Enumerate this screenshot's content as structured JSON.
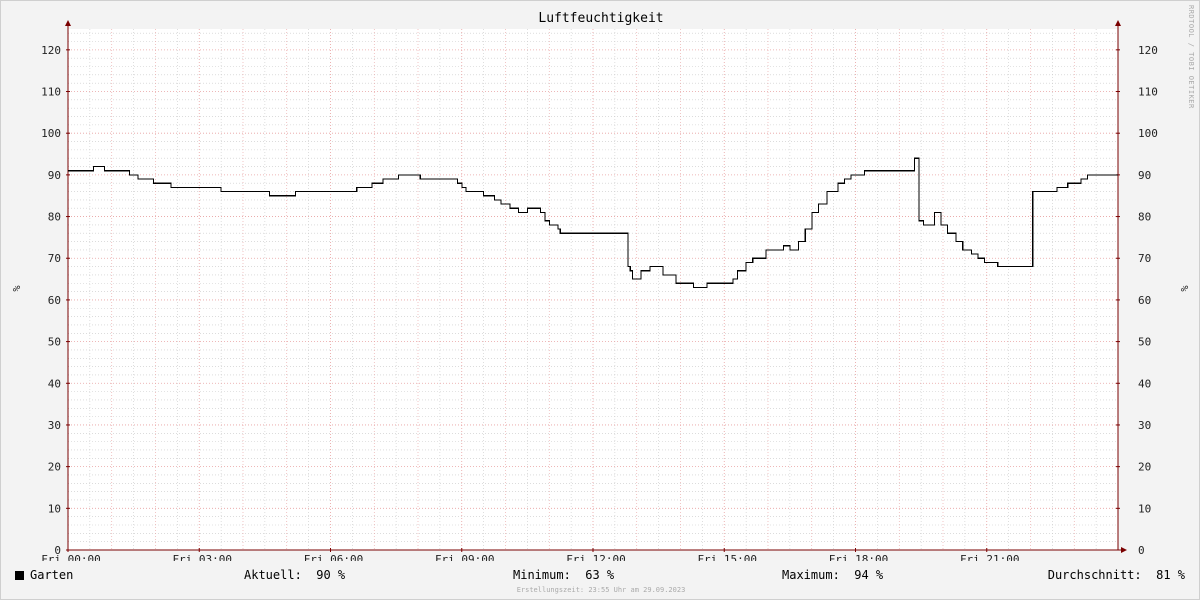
{
  "chart_data": {
    "type": "line",
    "title": "Luftfeuchtigkeit",
    "ylabel": "%",
    "ylim": [
      0,
      125
    ],
    "yticks": [
      0,
      10,
      20,
      30,
      40,
      50,
      60,
      70,
      80,
      90,
      100,
      110,
      120
    ],
    "xlim": [
      0,
      24
    ],
    "xticks": [
      {
        "x": 0,
        "label": "Fri 00:00"
      },
      {
        "x": 3,
        "label": "Fri 03:00"
      },
      {
        "x": 6,
        "label": "Fri 06:00"
      },
      {
        "x": 9,
        "label": "Fri 09:00"
      },
      {
        "x": 12,
        "label": "Fri 12:00"
      },
      {
        "x": 15,
        "label": "Fri 15:00"
      },
      {
        "x": 18,
        "label": "Fri 18:00"
      },
      {
        "x": 21,
        "label": "Fri 21:00"
      }
    ],
    "grid": true,
    "legend": "bottom-left",
    "series": [
      {
        "name": "Garten",
        "color": "#000000",
        "step": true,
        "points": [
          [
            0.0,
            91
          ],
          [
            0.58,
            92
          ],
          [
            0.83,
            91
          ],
          [
            1.4,
            90
          ],
          [
            1.6,
            89
          ],
          [
            1.95,
            88
          ],
          [
            2.35,
            87
          ],
          [
            3.5,
            86
          ],
          [
            4.6,
            85
          ],
          [
            5.2,
            86
          ],
          [
            6.6,
            87
          ],
          [
            6.95,
            88
          ],
          [
            7.2,
            89
          ],
          [
            7.55,
            90
          ],
          [
            8.05,
            89
          ],
          [
            8.9,
            88
          ],
          [
            9.0,
            87
          ],
          [
            9.1,
            86
          ],
          [
            9.5,
            85
          ],
          [
            9.75,
            84
          ],
          [
            9.9,
            83
          ],
          [
            10.1,
            82
          ],
          [
            10.3,
            81
          ],
          [
            10.5,
            82
          ],
          [
            10.8,
            81
          ],
          [
            10.9,
            79
          ],
          [
            11.0,
            78
          ],
          [
            11.2,
            77
          ],
          [
            11.25,
            76
          ],
          [
            12.8,
            68
          ],
          [
            12.85,
            67
          ],
          [
            12.9,
            65
          ],
          [
            13.1,
            67
          ],
          [
            13.3,
            68
          ],
          [
            13.6,
            66
          ],
          [
            13.9,
            64
          ],
          [
            14.3,
            63
          ],
          [
            14.6,
            64
          ],
          [
            15.2,
            65
          ],
          [
            15.3,
            67
          ],
          [
            15.5,
            69
          ],
          [
            15.65,
            70
          ],
          [
            15.95,
            72
          ],
          [
            16.35,
            73
          ],
          [
            16.5,
            72
          ],
          [
            16.7,
            74
          ],
          [
            16.85,
            77
          ],
          [
            17.0,
            81
          ],
          [
            17.15,
            83
          ],
          [
            17.35,
            86
          ],
          [
            17.6,
            88
          ],
          [
            17.75,
            89
          ],
          [
            17.9,
            90
          ],
          [
            18.2,
            91
          ],
          [
            19.35,
            94
          ],
          [
            19.45,
            79
          ],
          [
            19.55,
            78
          ],
          [
            19.8,
            81
          ],
          [
            19.95,
            78
          ],
          [
            20.1,
            76
          ],
          [
            20.3,
            74
          ],
          [
            20.45,
            72
          ],
          [
            20.65,
            71
          ],
          [
            20.8,
            70
          ],
          [
            20.95,
            69
          ],
          [
            21.25,
            68
          ],
          [
            22.05,
            86
          ],
          [
            22.6,
            87
          ],
          [
            22.85,
            88
          ],
          [
            23.15,
            89
          ],
          [
            23.3,
            90
          ],
          [
            24.0,
            90
          ]
        ]
      }
    ]
  },
  "watermark": "RRDTOOL / TOBI OETIKER",
  "legend": {
    "series_name": "Garten",
    "current_label": "Aktuell:",
    "current_value": "90 %",
    "minimum_label": "Minimum:",
    "minimum_value": "63 %",
    "maximum_label": "Maximum:",
    "maximum_value": "94 %",
    "average_label": "Durchschnitt:",
    "average_value": "81 %"
  },
  "footer": "Erstellungszeit: 23:55 Uhr am 29.09.2023",
  "colors": {
    "background": "#f3f3f3",
    "plot_background": "#ffffff",
    "minor_grid": "#c8c8c8",
    "major_grid": "#e8a0a0",
    "axis": "#7a0000",
    "line": "#000000"
  }
}
